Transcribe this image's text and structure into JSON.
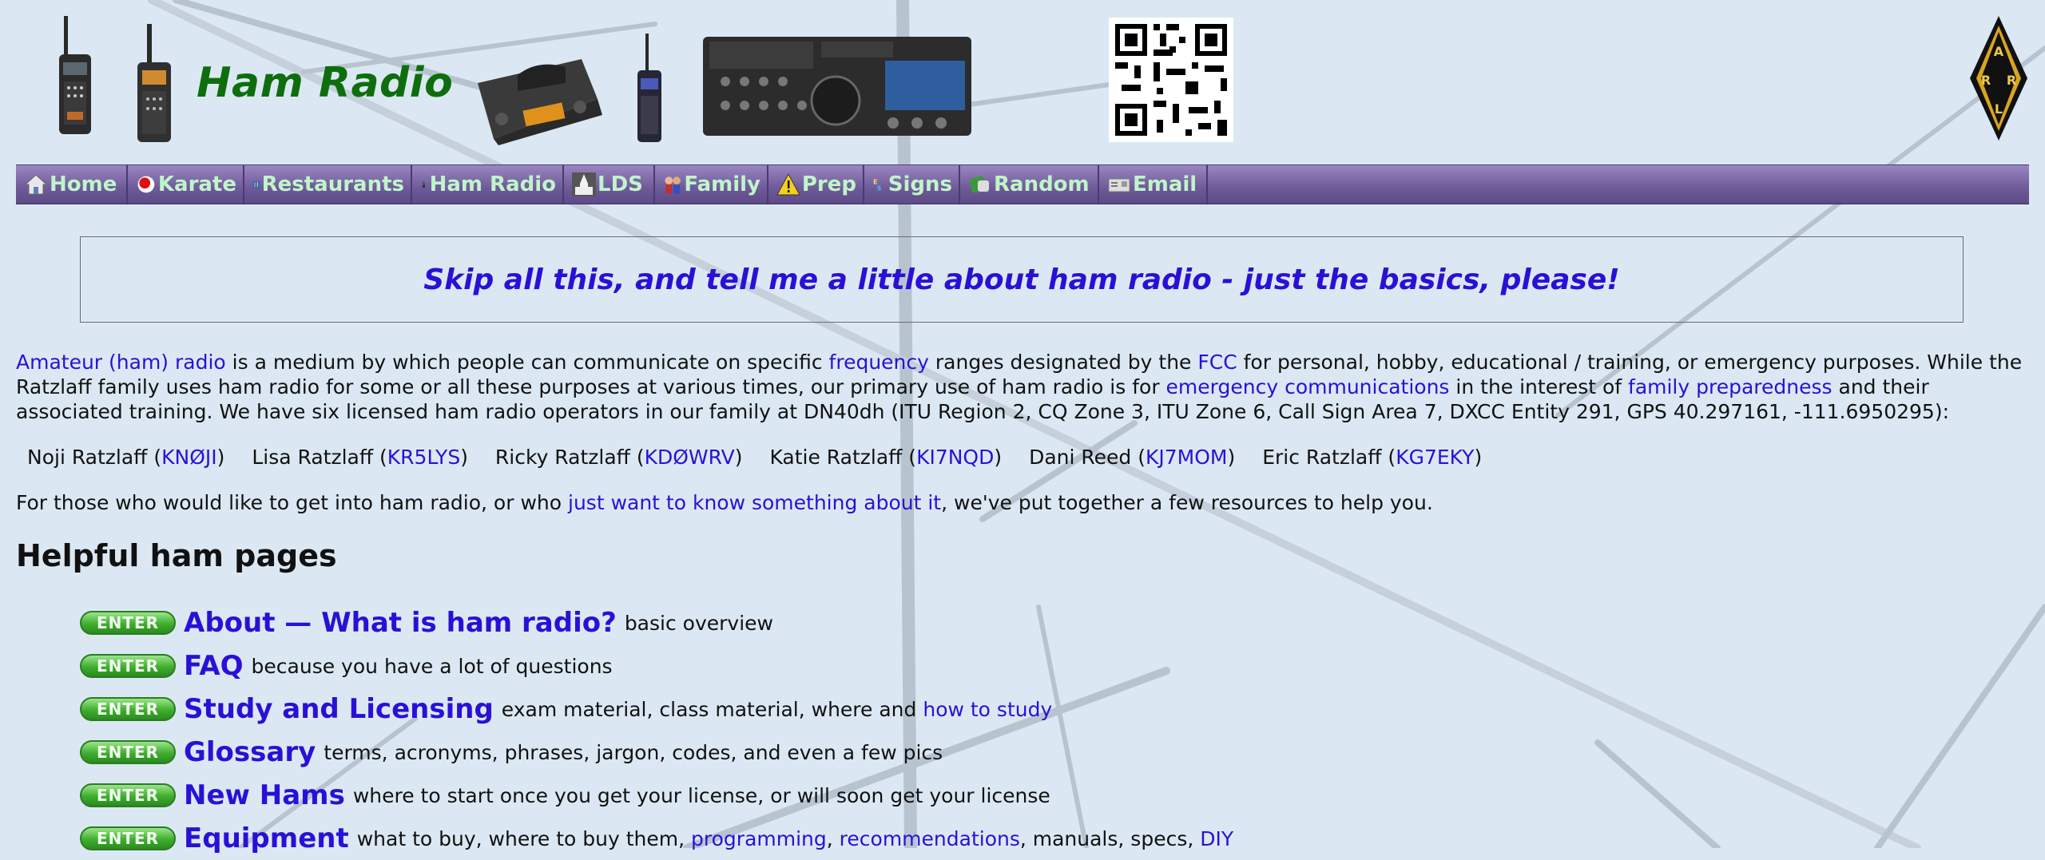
{
  "site": {
    "title": "Ham Radio",
    "logo_text": [
      "A",
      "R",
      "R",
      "L"
    ]
  },
  "nav": [
    {
      "label": "Home",
      "icon": "house-icon"
    },
    {
      "label": "Karate",
      "icon": "karate-icon"
    },
    {
      "label": "Restaurants",
      "icon": "fork-knife-icon"
    },
    {
      "label": "Ham Radio",
      "icon": "radio-icon"
    },
    {
      "label": "LDS",
      "icon": "temple-icon"
    },
    {
      "label": "Family",
      "icon": "family-icon"
    },
    {
      "label": "Prep",
      "icon": "warning-icon"
    },
    {
      "label": "Signs",
      "icon": "signs-icon"
    },
    {
      "label": "Random",
      "icon": "dice-icon"
    },
    {
      "label": "Email",
      "icon": "mail-icon"
    }
  ],
  "skip_link": "Skip all this, and tell me a little about ham radio - just the basics, please!",
  "intro": {
    "link_amateur": "Amateur (ham) radio",
    "t1": " is a medium by which people can communicate on specific ",
    "link_frequency": "frequency",
    "t2": " ranges designated by the ",
    "link_fcc": "FCC",
    "t3": " for personal, hobby, educational / training, or emergency purposes. While the Ratzlaff family uses ham radio for some or all these purposes at various times, our primary use of ham radio is for ",
    "link_emergency": "emergency communications",
    "t4": " in the interest of ",
    "link_family": "family preparedness",
    "t5": " and their associated training. We have six licensed ham radio operators in our family at DN40dh (ITU Region 2, CQ Zone 3, ITU Zone 6, Call Sign Area 7, DXCC Entity 291, GPS 40.297161, -111.6950295):"
  },
  "operators": [
    {
      "name": "Noji Ratzlaff",
      "call": "KNØJI"
    },
    {
      "name": "Lisa Ratzlaff",
      "call": "KR5LYS"
    },
    {
      "name": "Ricky Ratzlaff",
      "call": "KDØWRV"
    },
    {
      "name": "Katie Ratzlaff",
      "call": "KI7NQD"
    },
    {
      "name": "Dani Reed",
      "call": "KJ7MOM"
    },
    {
      "name": "Eric Ratzlaff",
      "call": "KG7EKY"
    }
  ],
  "resources": {
    "t1": "For those who would like to get into ham radio, or who ",
    "link": "just want to know something about it",
    "t2": ", we've put together a few resources to help you."
  },
  "helpful_heading": "Helpful ham pages",
  "enter_label": "ENTER",
  "pages": [
    {
      "title": "About — What is ham radio?",
      "desc": [
        {
          "text": "basic overview"
        }
      ]
    },
    {
      "title": "FAQ",
      "desc": [
        {
          "text": "because you have a lot of questions"
        }
      ]
    },
    {
      "title": "Study and Licensing",
      "desc": [
        {
          "text": "exam material, class material, where and "
        },
        {
          "text": "how to study",
          "link": true
        }
      ]
    },
    {
      "title": "Glossary",
      "desc": [
        {
          "text": "terms, acronyms, phrases, jargon, codes, and even a few pics"
        }
      ]
    },
    {
      "title": "New Hams",
      "desc": [
        {
          "text": "where to start once you get your license, or will soon get your license"
        }
      ]
    },
    {
      "title": "Equipment",
      "desc": [
        {
          "text": "what to buy, where to buy them, "
        },
        {
          "text": "programming",
          "link": true
        },
        {
          "text": ", "
        },
        {
          "text": "recommendations",
          "link": true
        },
        {
          "text": ", manuals, specs, "
        },
        {
          "text": "DIY",
          "link": true
        }
      ]
    }
  ]
}
